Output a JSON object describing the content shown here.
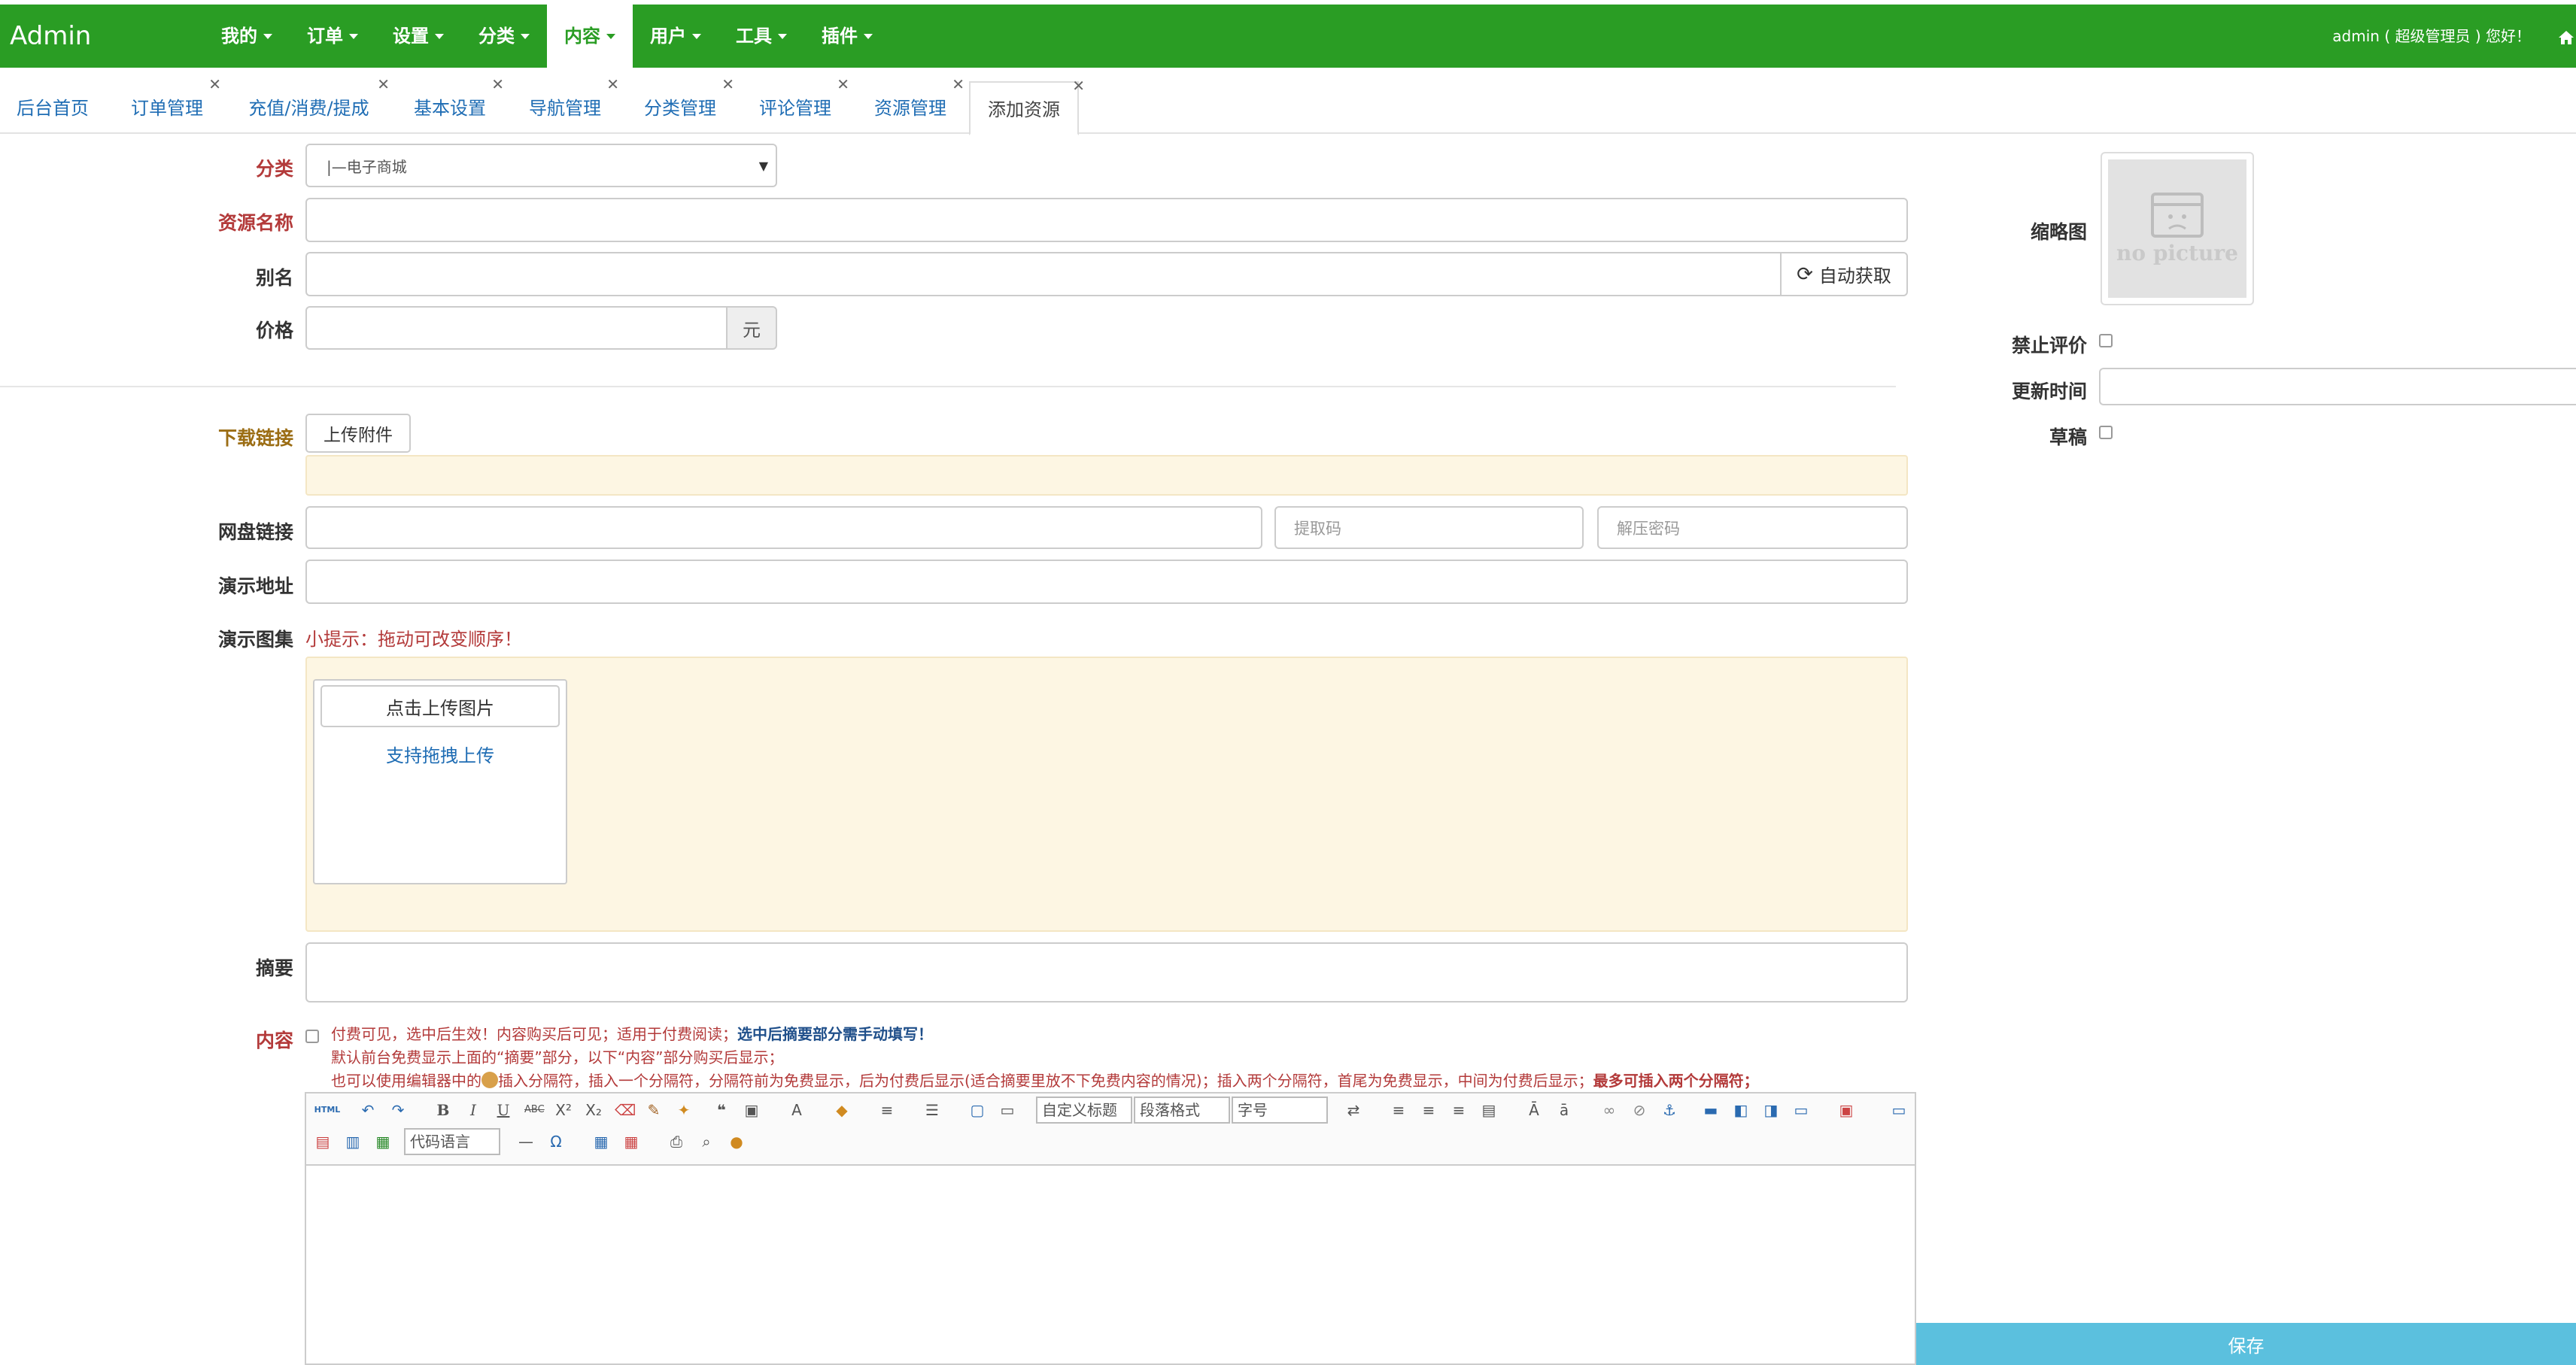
{
  "app": {
    "brand": "Admin"
  },
  "nav": {
    "items": [
      {
        "label": "我的"
      },
      {
        "label": "订单"
      },
      {
        "label": "设置"
      },
      {
        "label": "分类"
      },
      {
        "label": "内容",
        "active": true
      },
      {
        "label": "用户"
      },
      {
        "label": "工具"
      },
      {
        "label": "插件"
      }
    ],
    "user_text": "admin ( 超级管理员 ) 您好！"
  },
  "tabs": [
    {
      "label": "后台首页"
    },
    {
      "label": "订单管理"
    },
    {
      "label": "充值/消费/提成"
    },
    {
      "label": "基本设置"
    },
    {
      "label": "导航管理"
    },
    {
      "label": "分类管理"
    },
    {
      "label": "评论管理"
    },
    {
      "label": "资源管理"
    },
    {
      "label": "添加资源",
      "active": true
    }
  ],
  "form": {
    "category_label": "分类",
    "category_value": "|—电子商城",
    "name_label": "资源名称",
    "alias_label": "别名",
    "auto_fetch": "自动获取",
    "price_label": "价格",
    "price_unit": "元",
    "download_label": "下载链接",
    "upload_attachment": "上传附件",
    "netdisk_label": "网盘链接",
    "extract_code_placeholder": "提取码",
    "unzip_password_placeholder": "解压密码",
    "demo_url_label": "演示地址",
    "gallery_label": "演示图集",
    "gallery_tip": "小提示：拖动可改变顺序！",
    "upload_image_button": "点击上传图片",
    "drag_upload_text": "支持拖拽上传",
    "summary_label": "摘要",
    "content_label": "内容",
    "note_line1_a": "付费可见，选中后生效！内容购买后可见；适用于付费阅读；",
    "note_line1_b": "选中后摘要部分需手动填写！",
    "note_line2": "默认前台免费显示上面的“摘要”部分，以下“内容”部分购买后显示；",
    "note_line3_a": "也可以使用编辑器中的",
    "note_line3_b": "插入分隔符，插入一个分隔符，分隔符前为免费显示，后为付费后显示(适合摘要里放不下免费内容的情况)；插入两个分隔符，首尾为免费显示，中间为付费后显示；",
    "note_line3_c": "最多可插入两个分隔符；"
  },
  "editor": {
    "font_select": "自定义标题",
    "paragraph_select": "段落格式",
    "size_select": "字号",
    "code_lang_select": "代码语言"
  },
  "sidebar": {
    "thumbnail_label": "缩略图",
    "no_picture_text": "no picture",
    "disable_comment_label": "禁止评价",
    "update_time_label": "更新时间",
    "draft_label": "草稿"
  },
  "actions": {
    "save": "保存"
  },
  "colors": {
    "nav_green": "#2a9d24",
    "save_blue": "#5bc0de",
    "panel_yellow": "#fdf6e3"
  }
}
